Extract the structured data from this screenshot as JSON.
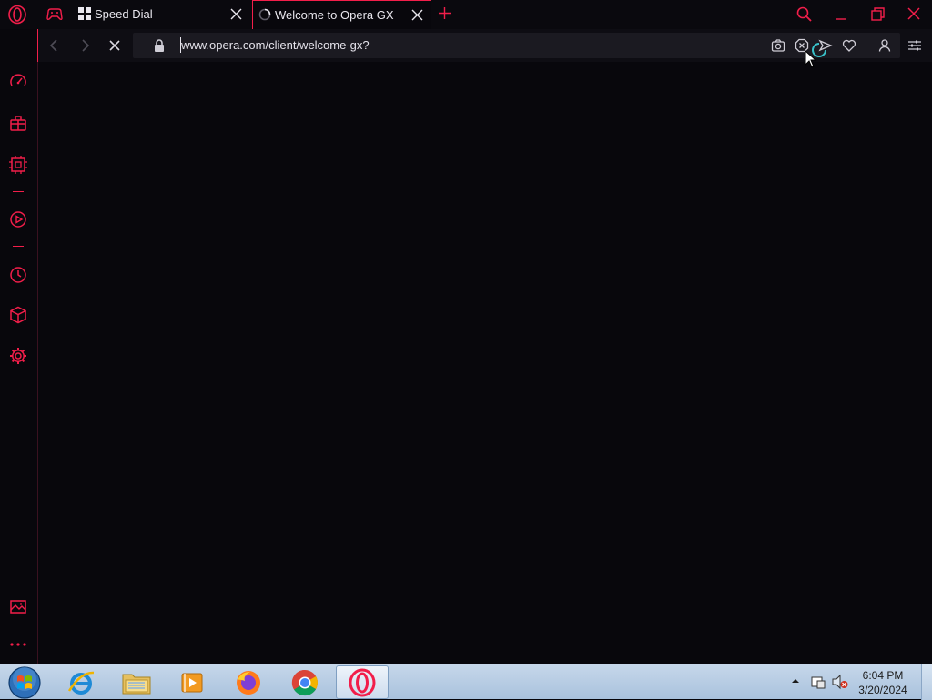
{
  "browser": {
    "name": "Opera GX",
    "accent_color": "#f21e4a"
  },
  "tabs": [
    {
      "title": "Speed Dial",
      "icon": "speed-dial-grid-icon",
      "active": false
    },
    {
      "title": "Welcome to Opera GX",
      "icon": "loading-spinner-icon",
      "active": true
    }
  ],
  "toolbar": {
    "url": "www.opera.com/client/welcome-gx?",
    "loading": true,
    "icons": [
      "back-icon",
      "forward-icon",
      "stop-icon",
      "lock-icon",
      "snapshot-camera-icon",
      "adblock-icon",
      "vpn-icon",
      "bookmark-heart-icon",
      "account-icon",
      "easy-setup-icon"
    ]
  },
  "sidebar": {
    "items": [
      "gx-control-icon",
      "gx-corner-icon",
      "hot-tabs-killer-icon",
      "player-icon",
      "history-icon",
      "extensions-icon",
      "settings-icon",
      "pinboard-icon",
      "more-icon"
    ]
  },
  "taskbar": {
    "apps": [
      "internet-explorer-icon",
      "windows-explorer-icon",
      "media-player-icon",
      "firefox-icon",
      "chrome-icon",
      "opera-gx-icon"
    ],
    "time": "6:04 PM",
    "date": "3/20/2024"
  }
}
